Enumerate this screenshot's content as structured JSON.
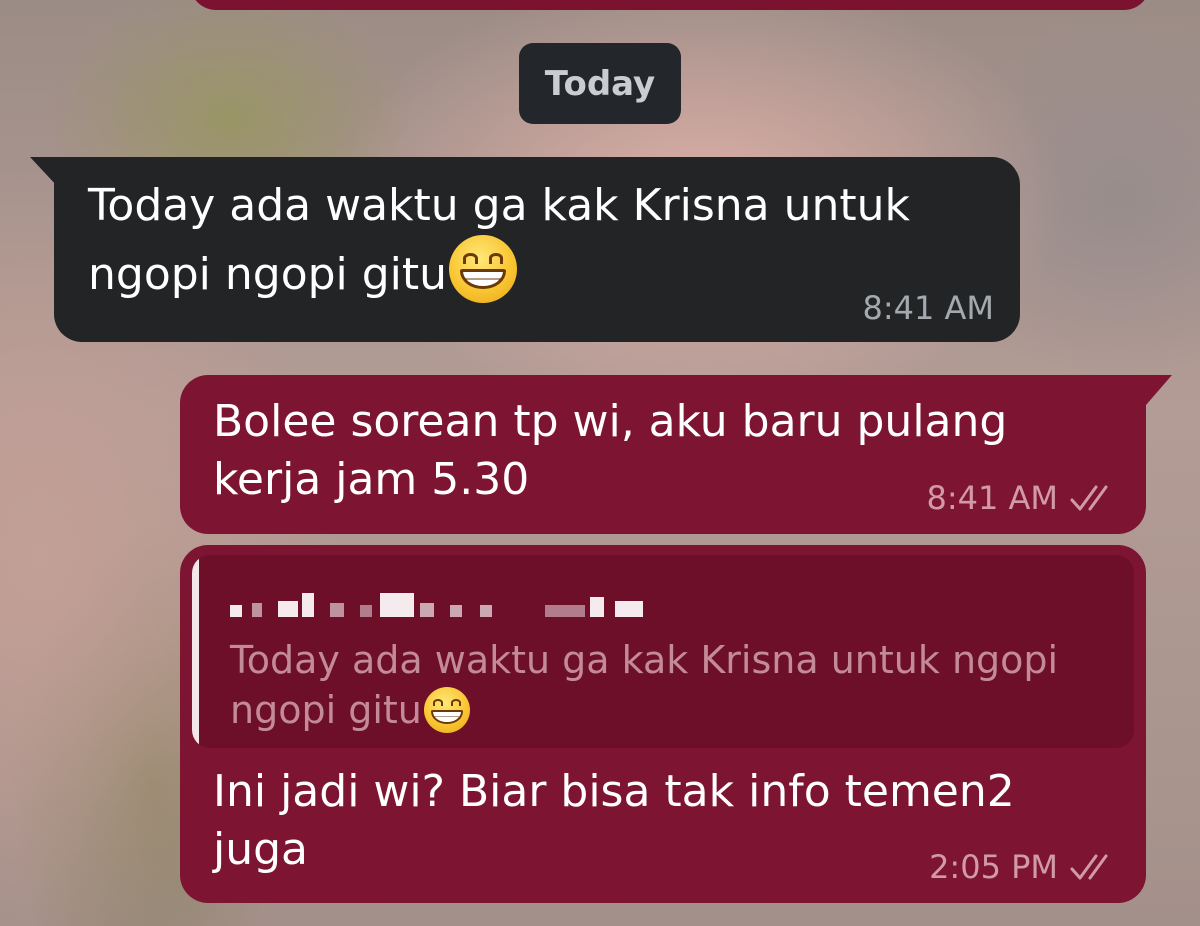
{
  "date_separator": "Today",
  "messages": [
    {
      "direction": "incoming",
      "text": "Today ada waktu ga kak Krisna untuk ngopi ngopi gitu",
      "emoji": "grinning-face-with-smiling-eyes",
      "time": "8:41 AM"
    },
    {
      "direction": "outgoing",
      "text": "Bolee sorean tp wi, aku baru pulang kerja jam 5.30",
      "time": "8:41 AM",
      "status_icon": "double-check-icon"
    },
    {
      "direction": "outgoing",
      "reply_to": {
        "author": "",
        "text": "Today ada waktu ga kak Krisna untuk ngopi ngopi gitu",
        "emoji": "grinning-face-with-smiling-eyes"
      },
      "text": "Ini jadi wi? Biar bisa tak info temen2 juga",
      "time": "2:05 PM",
      "status_icon": "double-check-icon"
    }
  ],
  "colors": {
    "incoming_bubble": "#222426",
    "outgoing_bubble": "#7d1532",
    "quote_background": "#6d0f28",
    "date_pill": "#23262a"
  }
}
